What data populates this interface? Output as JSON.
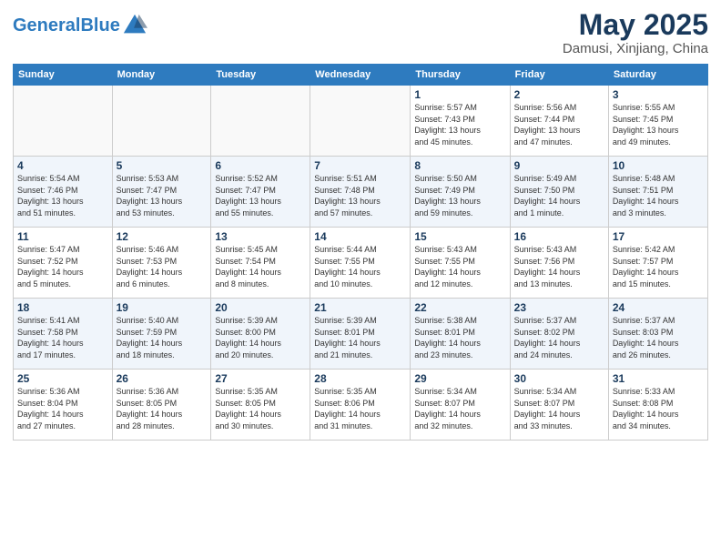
{
  "header": {
    "logo_general": "General",
    "logo_blue": "Blue",
    "month_title": "May 2025",
    "location": "Damusi, Xinjiang, China"
  },
  "weekdays": [
    "Sunday",
    "Monday",
    "Tuesday",
    "Wednesday",
    "Thursday",
    "Friday",
    "Saturday"
  ],
  "weeks": [
    [
      {
        "day": "",
        "info": ""
      },
      {
        "day": "",
        "info": ""
      },
      {
        "day": "",
        "info": ""
      },
      {
        "day": "",
        "info": ""
      },
      {
        "day": "1",
        "info": "Sunrise: 5:57 AM\nSunset: 7:43 PM\nDaylight: 13 hours\nand 45 minutes."
      },
      {
        "day": "2",
        "info": "Sunrise: 5:56 AM\nSunset: 7:44 PM\nDaylight: 13 hours\nand 47 minutes."
      },
      {
        "day": "3",
        "info": "Sunrise: 5:55 AM\nSunset: 7:45 PM\nDaylight: 13 hours\nand 49 minutes."
      }
    ],
    [
      {
        "day": "4",
        "info": "Sunrise: 5:54 AM\nSunset: 7:46 PM\nDaylight: 13 hours\nand 51 minutes."
      },
      {
        "day": "5",
        "info": "Sunrise: 5:53 AM\nSunset: 7:47 PM\nDaylight: 13 hours\nand 53 minutes."
      },
      {
        "day": "6",
        "info": "Sunrise: 5:52 AM\nSunset: 7:47 PM\nDaylight: 13 hours\nand 55 minutes."
      },
      {
        "day": "7",
        "info": "Sunrise: 5:51 AM\nSunset: 7:48 PM\nDaylight: 13 hours\nand 57 minutes."
      },
      {
        "day": "8",
        "info": "Sunrise: 5:50 AM\nSunset: 7:49 PM\nDaylight: 13 hours\nand 59 minutes."
      },
      {
        "day": "9",
        "info": "Sunrise: 5:49 AM\nSunset: 7:50 PM\nDaylight: 14 hours\nand 1 minute."
      },
      {
        "day": "10",
        "info": "Sunrise: 5:48 AM\nSunset: 7:51 PM\nDaylight: 14 hours\nand 3 minutes."
      }
    ],
    [
      {
        "day": "11",
        "info": "Sunrise: 5:47 AM\nSunset: 7:52 PM\nDaylight: 14 hours\nand 5 minutes."
      },
      {
        "day": "12",
        "info": "Sunrise: 5:46 AM\nSunset: 7:53 PM\nDaylight: 14 hours\nand 6 minutes."
      },
      {
        "day": "13",
        "info": "Sunrise: 5:45 AM\nSunset: 7:54 PM\nDaylight: 14 hours\nand 8 minutes."
      },
      {
        "day": "14",
        "info": "Sunrise: 5:44 AM\nSunset: 7:55 PM\nDaylight: 14 hours\nand 10 minutes."
      },
      {
        "day": "15",
        "info": "Sunrise: 5:43 AM\nSunset: 7:55 PM\nDaylight: 14 hours\nand 12 minutes."
      },
      {
        "day": "16",
        "info": "Sunrise: 5:43 AM\nSunset: 7:56 PM\nDaylight: 14 hours\nand 13 minutes."
      },
      {
        "day": "17",
        "info": "Sunrise: 5:42 AM\nSunset: 7:57 PM\nDaylight: 14 hours\nand 15 minutes."
      }
    ],
    [
      {
        "day": "18",
        "info": "Sunrise: 5:41 AM\nSunset: 7:58 PM\nDaylight: 14 hours\nand 17 minutes."
      },
      {
        "day": "19",
        "info": "Sunrise: 5:40 AM\nSunset: 7:59 PM\nDaylight: 14 hours\nand 18 minutes."
      },
      {
        "day": "20",
        "info": "Sunrise: 5:39 AM\nSunset: 8:00 PM\nDaylight: 14 hours\nand 20 minutes."
      },
      {
        "day": "21",
        "info": "Sunrise: 5:39 AM\nSunset: 8:01 PM\nDaylight: 14 hours\nand 21 minutes."
      },
      {
        "day": "22",
        "info": "Sunrise: 5:38 AM\nSunset: 8:01 PM\nDaylight: 14 hours\nand 23 minutes."
      },
      {
        "day": "23",
        "info": "Sunrise: 5:37 AM\nSunset: 8:02 PM\nDaylight: 14 hours\nand 24 minutes."
      },
      {
        "day": "24",
        "info": "Sunrise: 5:37 AM\nSunset: 8:03 PM\nDaylight: 14 hours\nand 26 minutes."
      }
    ],
    [
      {
        "day": "25",
        "info": "Sunrise: 5:36 AM\nSunset: 8:04 PM\nDaylight: 14 hours\nand 27 minutes."
      },
      {
        "day": "26",
        "info": "Sunrise: 5:36 AM\nSunset: 8:05 PM\nDaylight: 14 hours\nand 28 minutes."
      },
      {
        "day": "27",
        "info": "Sunrise: 5:35 AM\nSunset: 8:05 PM\nDaylight: 14 hours\nand 30 minutes."
      },
      {
        "day": "28",
        "info": "Sunrise: 5:35 AM\nSunset: 8:06 PM\nDaylight: 14 hours\nand 31 minutes."
      },
      {
        "day": "29",
        "info": "Sunrise: 5:34 AM\nSunset: 8:07 PM\nDaylight: 14 hours\nand 32 minutes."
      },
      {
        "day": "30",
        "info": "Sunrise: 5:34 AM\nSunset: 8:07 PM\nDaylight: 14 hours\nand 33 minutes."
      },
      {
        "day": "31",
        "info": "Sunrise: 5:33 AM\nSunset: 8:08 PM\nDaylight: 14 hours\nand 34 minutes."
      }
    ]
  ]
}
